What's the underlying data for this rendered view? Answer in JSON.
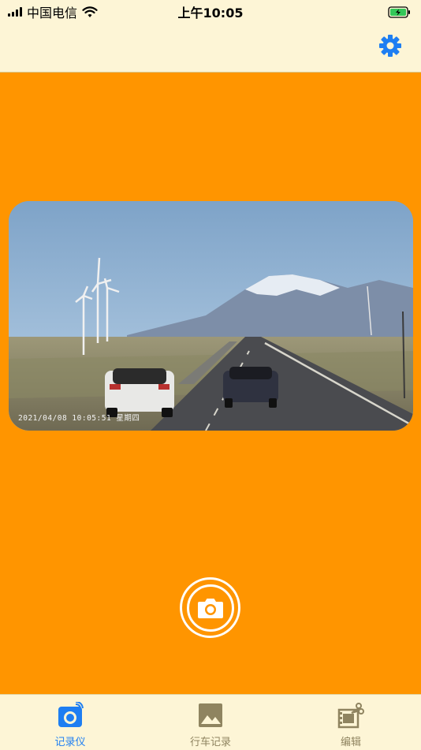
{
  "status_bar": {
    "carrier": "中国电信",
    "time": "上午10:05",
    "battery_state": "charging"
  },
  "nav": {
    "settings_icon": "gear-icon"
  },
  "camera_preview": {
    "timestamp_overlay": "2021/04/08  10:05:51 星期四"
  },
  "capture_button": {
    "icon": "camera-icon"
  },
  "tabs": [
    {
      "label": "记录仪",
      "icon": "dashcam-icon",
      "active": true
    },
    {
      "label": "行车记录",
      "icon": "image-icon",
      "active": false
    },
    {
      "label": "编辑",
      "icon": "film-edit-icon",
      "active": false
    }
  ],
  "colors": {
    "accent_blue": "#1e7ef2",
    "background_orange": "#ff9500",
    "bar_cream": "#fdf5d6",
    "inactive_tab": "#8f8460"
  }
}
